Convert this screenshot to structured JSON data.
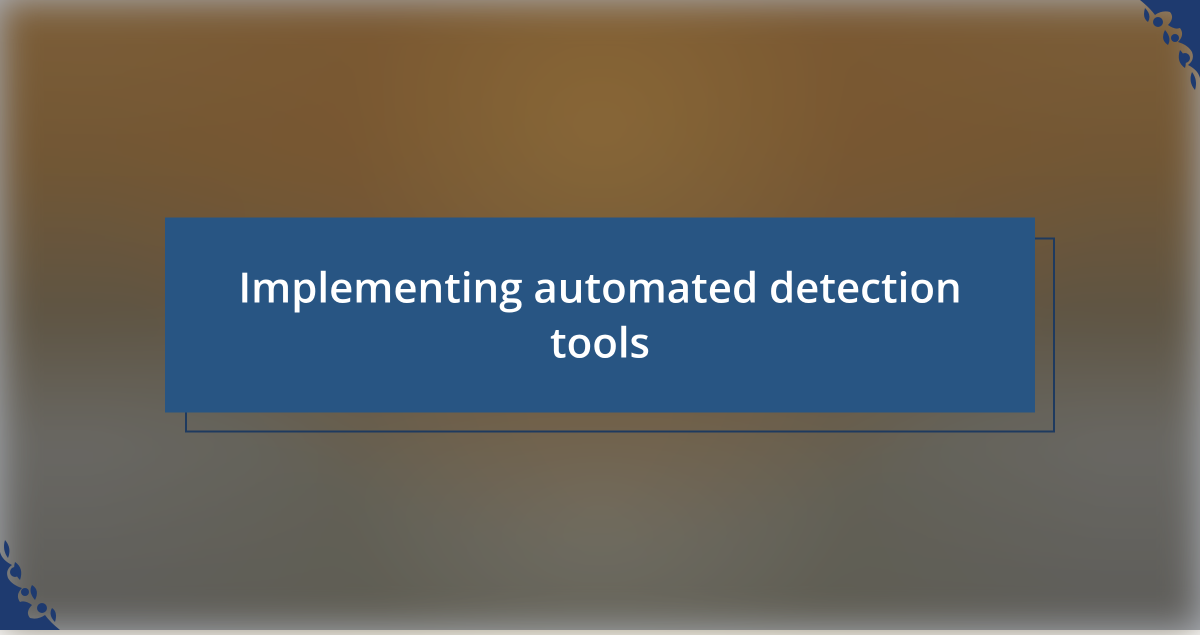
{
  "title": {
    "text": "Implementing automated detection tools"
  },
  "colors": {
    "titleBoxBg": "#285583",
    "titleBorder": "#1e3a5f",
    "titleText": "#ffffff",
    "ornament": "#1e3a6f"
  }
}
